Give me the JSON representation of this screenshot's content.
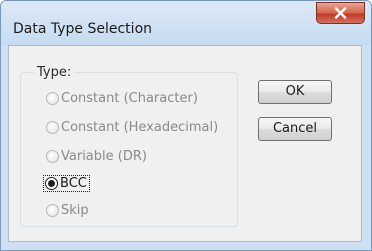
{
  "window": {
    "title": "Data Type Selection"
  },
  "group": {
    "label": "Type:"
  },
  "options": [
    {
      "label": "Constant (Character)",
      "checked": false
    },
    {
      "label": "Constant (Hexadecimal)",
      "checked": false
    },
    {
      "label": "Variable (DR)",
      "checked": false
    },
    {
      "label": "BCC",
      "checked": true
    },
    {
      "label": "Skip",
      "checked": false
    }
  ],
  "buttons": {
    "ok": "OK",
    "cancel": "Cancel"
  },
  "icons": {
    "close": "close-icon"
  },
  "colors": {
    "close_button": "#c84a34",
    "title_bar": "#cfe0f3"
  }
}
